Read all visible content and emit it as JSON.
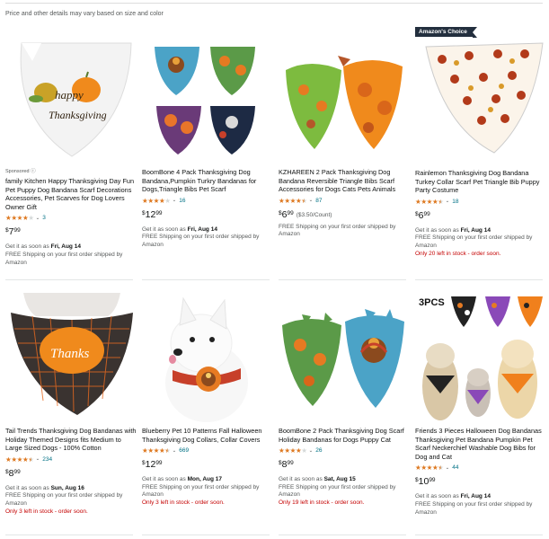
{
  "header": {
    "note": "Price and other details may vary based on size and color"
  },
  "badge": "Amazon's Choice",
  "sponsored_label": "Sponsored",
  "delivery_prefix": "Get it as soon as",
  "products": [
    {
      "title": "family Kitchen Happy Thanksgiving Day Fun Pet Puppy Dog Bandana Scarf Decorations Accessories, Pet Scarves for Dog Lovers Owner Gift",
      "rating": 4.0,
      "review_count": "3",
      "price_currency": "$",
      "price_whole": "7",
      "price_fraction": "99",
      "unit_price": "",
      "delivery_date": "Fri, Aug 14",
      "shipping": "FREE Shipping on your first order shipped by Amazon",
      "stock": "",
      "sponsored": true,
      "amazons_choice": false,
      "image_text": [
        "happy",
        "Thanksgiving"
      ]
    },
    {
      "title": "BoomBone 4 Pack Thanksgiving Dog Bandana,Pumpkin Turkry Bandanas for Dogs,Triangle Bibs Pet Scarf",
      "rating": 4.0,
      "review_count": "16",
      "price_currency": "$",
      "price_whole": "12",
      "price_fraction": "99",
      "unit_price": "",
      "delivery_date": "Fri, Aug 14",
      "shipping": "FREE Shipping on your first order shipped by Amazon",
      "stock": "",
      "sponsored": false,
      "amazons_choice": false,
      "image_text": []
    },
    {
      "title": "KZHAREEN 2 Pack Thanksgiving Dog Bandana Reversible Triangle Bibs Scarf Accessories for Dogs Cats Pets Animals",
      "rating": 4.5,
      "review_count": "87",
      "price_currency": "$",
      "price_whole": "6",
      "price_fraction": "99",
      "unit_price": "($3.50/Count)",
      "delivery_date": "",
      "shipping": "FREE Shipping on your first order shipped by Amazon",
      "stock": "",
      "sponsored": false,
      "amazons_choice": false,
      "image_text": []
    },
    {
      "title": "Rainlemon Thanksgiving Dog Bandana Turkey Collar Scarf Pet Triangle Bib Puppy Party Costume",
      "rating": 4.5,
      "review_count": "18",
      "price_currency": "$",
      "price_whole": "6",
      "price_fraction": "99",
      "unit_price": "",
      "delivery_date": "Fri, Aug 14",
      "shipping": "FREE Shipping on your first order shipped by Amazon",
      "stock": "Only 20 left in stock - order soon.",
      "sponsored": false,
      "amazons_choice": true,
      "image_text": []
    },
    {
      "title": "Tail Trends Thanksgiving Dog Bandanas with Holiday Themed Designs fits Medium to Large Sized Dogs - 100% Cotton",
      "rating": 4.5,
      "review_count": "234",
      "price_currency": "$",
      "price_whole": "8",
      "price_fraction": "99",
      "unit_price": "",
      "delivery_date": "Sun, Aug 16",
      "shipping": "FREE Shipping on your first order shipped by Amazon",
      "stock": "Only 3 left in stock - order soon.",
      "sponsored": false,
      "amazons_choice": false,
      "image_text": [
        "Thanks"
      ]
    },
    {
      "title": "Blueberry Pet 10 Patterns Fall Halloween Thanksgiving Dog Collars, Collar Covers",
      "rating": 4.5,
      "review_count": "669",
      "price_currency": "$",
      "price_whole": "12",
      "price_fraction": "99",
      "unit_price": "",
      "delivery_date": "Mon, Aug 17",
      "shipping": "FREE Shipping on your first order shipped by Amazon",
      "stock": "Only 3 left in stock - order soon.",
      "sponsored": false,
      "amazons_choice": false,
      "image_text": []
    },
    {
      "title": "BoomBone 2 Pack Thanksgiving Dog Scarf Holiday Bandanas for Dogs Puppy Cat",
      "rating": 4.0,
      "review_count": "26",
      "price_currency": "$",
      "price_whole": "8",
      "price_fraction": "99",
      "unit_price": "",
      "delivery_date": "Sat, Aug 15",
      "shipping": "FREE Shipping on your first order shipped by Amazon",
      "stock": "Only 19 left in stock - order soon.",
      "sponsored": false,
      "amazons_choice": false,
      "image_text": []
    },
    {
      "title": "Friends 3 Pieces Halloween Dog Bandanas Thanksgiving Pet Bandana Pumpkin Pet Scarf Neckerchief Washable Dog Bibs for Dog and Cat",
      "rating": 4.5,
      "review_count": "44",
      "price_currency": "$",
      "price_whole": "10",
      "price_fraction": "99",
      "unit_price": "",
      "delivery_date": "Fri, Aug 14",
      "shipping": "FREE Shipping on your first order shipped by Amazon",
      "stock": "",
      "sponsored": false,
      "amazons_choice": false,
      "image_text": [
        "3PCS"
      ]
    }
  ],
  "colors": {
    "link": "#007185",
    "star": "#de7921",
    "stock_warning": "#c40000",
    "badge_bg": "#232f3e",
    "muted": "#565959"
  }
}
